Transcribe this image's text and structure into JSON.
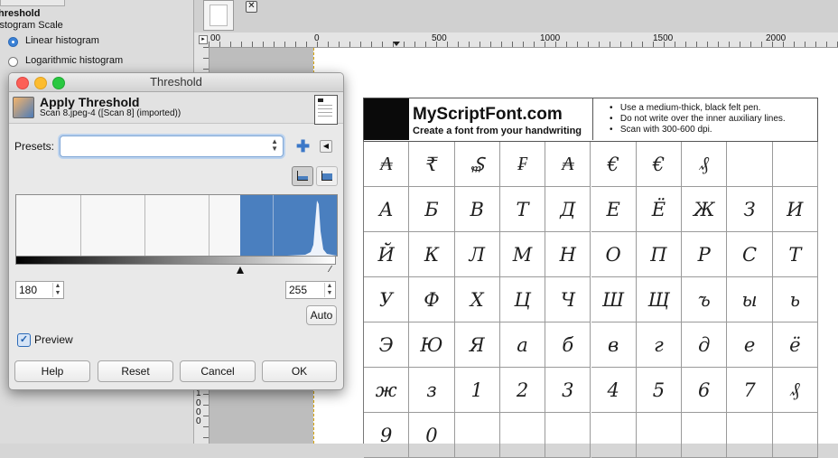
{
  "dock": {
    "title": "hreshold",
    "subtitle": "istogram Scale",
    "options": [
      "Linear histogram",
      "Logarithmic histogram"
    ],
    "selected": 0
  },
  "ruler": {
    "top_ticks": [
      "00",
      "0",
      "500",
      "1000",
      "1500",
      "2000"
    ],
    "left_ticks": [
      "1",
      "0",
      "0",
      "0"
    ]
  },
  "dialog": {
    "window_title": "Threshold",
    "heading": "Apply Threshold",
    "source": "Scan 8.jpeg-4 ([Scan 8] (imported))",
    "presets_label": "Presets:",
    "presets_value": "",
    "low_value": "180",
    "high_value": "255",
    "auto_label": "Auto",
    "preview_label": "Preview",
    "preview_checked": true,
    "buttons": {
      "help": "Help",
      "reset": "Reset",
      "cancel": "Cancel",
      "ok": "OK"
    },
    "accent": "#4a7fbf"
  },
  "sheet": {
    "brand": "MyScriptFont.com",
    "tagline": "Create a font from your handwriting",
    "tips": [
      "Use a medium-thick, black felt pen.",
      "Do not write over the inner auxiliary lines.",
      "Scan with 300-600 dpi."
    ],
    "rows": [
      [
        "₳",
        "₹",
        "₷",
        "₣",
        "₳",
        "€",
        "€",
        "₰",
        "",
        ""
      ],
      [
        "А",
        "Б",
        "В",
        "Т",
        "Д",
        "Е",
        "Ё",
        "Ж",
        "З",
        "И"
      ],
      [
        "Й",
        "К",
        "Л",
        "М",
        "Н",
        "О",
        "П",
        "Р",
        "С",
        "Т"
      ],
      [
        "У",
        "Ф",
        "Х",
        "Ц",
        "Ч",
        "Ш",
        "Щ",
        "ъ",
        "ы",
        "ь"
      ],
      [
        "Э",
        "Ю",
        "Я",
        "а",
        "б",
        "в",
        "г",
        "д",
        "е",
        "ё"
      ],
      [
        "ж",
        "з",
        "1",
        "2",
        "3",
        "4",
        "5",
        "6",
        "7",
        "₰"
      ],
      [
        "9",
        "0",
        "",
        "",
        "",
        "",
        "",
        "",
        "",
        ""
      ]
    ]
  }
}
